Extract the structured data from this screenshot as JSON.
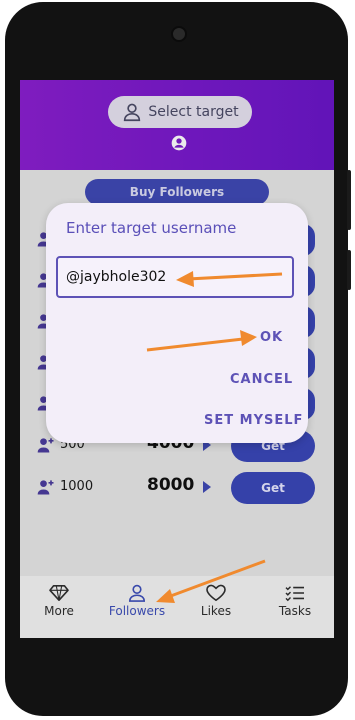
{
  "header": {
    "select_target_label": "Select target"
  },
  "buy_followers_label": "Buy Followers",
  "packages": [
    {
      "quantity": "500",
      "price": "4000",
      "button": "Get"
    },
    {
      "quantity": "1000",
      "price": "8000",
      "button": "Get"
    }
  ],
  "dialog": {
    "title": "Enter target username",
    "input_value": "@jaybhole302",
    "ok_label": "OK",
    "cancel_label": "CANCEL",
    "set_myself_label": "SET MYSELF"
  },
  "bottom_nav": {
    "items": [
      {
        "label": "More",
        "icon": "diamond-icon"
      },
      {
        "label": "Followers",
        "icon": "person-icon",
        "active": true
      },
      {
        "label": "Likes",
        "icon": "heart-icon"
      },
      {
        "label": "Tasks",
        "icon": "checklist-icon"
      }
    ]
  },
  "colors": {
    "header_gradient_start": "#8a1fd0",
    "header_gradient_end": "#6a16c8",
    "accent": "#3a47b8",
    "dialog_accent": "#5d52b6",
    "annotation_arrow": "#f08a2e"
  }
}
